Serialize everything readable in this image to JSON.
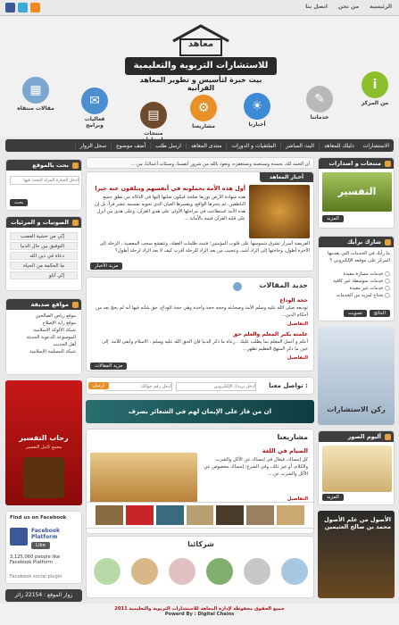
{
  "topbar": {
    "links": [
      "الرئيسية",
      "من نحن",
      "اتصل بنا"
    ],
    "social": [
      "rss-icon",
      "twitter-icon",
      "facebook-icon"
    ]
  },
  "header": {
    "logo_word": "معاهد",
    "logo_banner": "للاستشارات التربوية والتعليمية",
    "logo_sub": "بيت خبرة لتأسيس و تطوير المعاهد القرآنية",
    "icons": [
      {
        "label": "من المركز",
        "icon": "info-icon",
        "color": "#8cbf2c"
      },
      {
        "label": "خدماتنا",
        "icon": "pen-icon",
        "color": "#b9b9b9"
      },
      {
        "label": "أخبارنا",
        "icon": "lightbulb-icon",
        "color": "#3d8ad6"
      },
      {
        "label": "منتجات وإصدارات",
        "icon": "book-icon",
        "color": "#6d4b2c"
      },
      {
        "label": "مشاريعنا",
        "icon": "gear-icon",
        "color": "#e8902a"
      },
      {
        "label": "فعاليات وبرامج",
        "icon": "speech-icon",
        "color": "#4b8fd1"
      },
      {
        "label": "مقالات منتقاه",
        "icon": "document-icon",
        "color": "#7aa6d0"
      }
    ]
  },
  "nav": [
    "الاستشارات",
    "دليلك للمعاهد",
    "البث المباشر",
    "الملتقيات و الدورات",
    "منتدى المعاهد",
    "ارسل طلب",
    "أضف موضوع",
    "سجل الزوار"
  ],
  "ticker": "أن الحمد لله، نحمده ونستعينه ونستغفره، ونعوذ بالله من شرور أنفسنا، وسيئات أعمالنا، من ...",
  "right_col": {
    "products_title": "منتجات و اصدارات",
    "products_banner": "التفسير",
    "more": "المزيد",
    "share_title": "شارك برأيك",
    "poll_question": "ما رأيك في الخدمات التي يقدمها المركز على موقعه الإلكتروني ؟",
    "poll_options": [
      "خدمات ممتازة مفيدة",
      "خدمات متوسطة غير كافية",
      "خدمات غير مفيدة",
      "نحتاج لمزيد من الخدمات"
    ],
    "vote": "تصويت",
    "results": "النتائج",
    "consult_banner": "ركن الاستشارات",
    "image_title": "ألبوم الصور",
    "image_caption": "الأصول من علم الأصول محمد بن صالح العثيمين"
  },
  "left_col": {
    "search_title": "بحث بالموقع",
    "search_placeholder": "ادخل العبارة المراد البحث فيها",
    "search_btn": "بحث",
    "audio_title": "الصوتيات و المرئيات",
    "audio_items": [
      "إنّي من خشية الغضب",
      "التوفيق بين حال الدنيا",
      "دعاة في دين الله",
      "ما الحكمة من الحياة",
      "إنّي أتلو"
    ],
    "sites_title": "مواقع صديقة",
    "sites": [
      "موقع رياض الصالحين",
      "موقع راية الإصلاح",
      "شبكة الألوكة الاسلامية",
      "الموسوعة الدعوية الحديثة",
      "أهل الحديث",
      "شبكة المسلمة الإسلامية"
    ],
    "ad_title": "رحاب التفسير",
    "ad_sub": "مجمع كامل التفسير",
    "fb_title": "Find us on Facebook",
    "fb_name": "Facebook Platform",
    "fb_like": "Like",
    "fb_count": "3,125,060 people like Facebook Platform",
    "fb_plugin": "Facebook social plugin",
    "visitors": "زوار الموقع : 22154 زائر"
  },
  "center": {
    "news_title": "أخبار المعاهد",
    "news_headline": "أول هذه الأمة بحملونه في أنفسهم ويتلقون عنه خيرا",
    "news_body": "هذه شهادة الأرض توزيعا صلحة فيكون صلتها إليها في الدلالة من نطق جميع الناطقين. ثم يتحرها الواقع، ويفسرها العيان الذي تحويه بقسمه عشر قراً، بل إن هذه الأمة استطاعت في مراحلها الأولى على هدى القرآن، وعلى هدى من أنزل على قلبه القرآن فيمه بالأمانة ...",
    "news_body2": "الفريضة أسرار تشرق شموسها على قلوب المؤمنين؛ فتبدد ظلمات الغفلة، وتتقشع سحب المعصية ، الرحلة إلى الآخرة أطول، وحاجتها إلى الزاد أشد، وعجيب من يعد الزاد للرحلة أقرب كيف لا يعد الزاد لرحلة أطول؟",
    "more_news": "مزيد الأخبار",
    "articles_title": "جديد المقالات",
    "a1_title": "حجة الوداع",
    "a1_body": "توديعه صلى الله عليه وسلم الأمة وصحابته وحجه حجة واحدة وهي حجة الوداع، حق شأنه فيها أنه لم يحج بعد من أحكام الدين...",
    "a1_more": "التفاصيل",
    "a2_title": "علمته يكبر المعلم والعلم حق",
    "a2_body": "أعلم و أعمل المعلم بما يطلب عليك ، رعاه ما ذكر الدنيا فإن الحق الله عليه وسلم ، الاسلام وأبقى للأمة. إلى حين ما ذكر المنهج العظيم تظهر...",
    "a2_more": "التفاصيل",
    "more_articles": "مزيد المقالات",
    "contact_title": "تواصل معنا :",
    "contact_mail": "أدخل بريدك الإلكتروني",
    "contact_phone": "أدخل رقم جوالك",
    "contact_btn": "ارسل",
    "banner": "ان من فاز على الإيمان لهم في الشعائر بصرف",
    "projects_title": "مشاريعنا",
    "project_headline": "الصيام في اللغة",
    "project_body": "كل إمساك، فيقال في إمساك عن الأكل والشرب والكلام، أو غير ذلك، وفي الشرع: إمساك مخصوص عن الأكل والشرب عن ...",
    "project_more": "التفاصيل",
    "partners_title": "شركائنا"
  },
  "footer": {
    "copyright": "جميع الحقوق محفوظة لإدارة المعاهد للاستشارات التربوية والتعليمية 2011",
    "powered": "Powerd By : Digital Chains"
  }
}
